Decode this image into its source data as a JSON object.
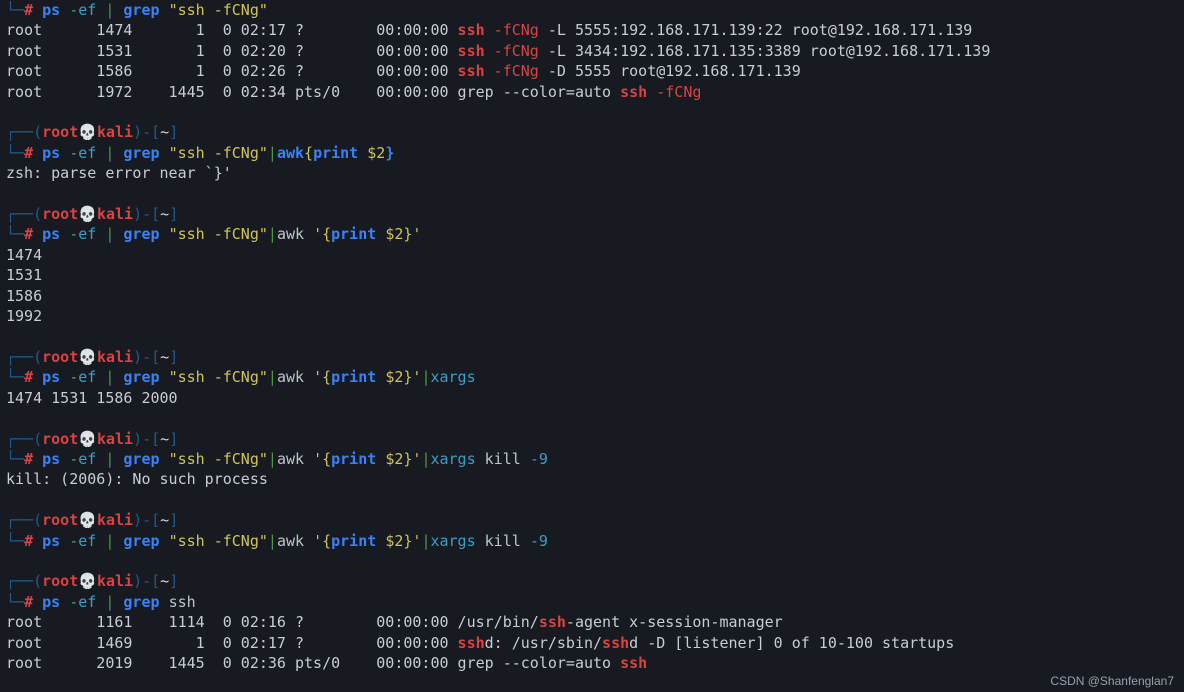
{
  "watermark": "CSDN @Shanfenglan7",
  "prompt": {
    "l1": "┌──(",
    "user": "root",
    "skull": "💀",
    "host": "kali",
    "l2": ")-[",
    "cwd": "~",
    "l3": "]",
    "l4": "└─",
    "hash": "#"
  },
  "cmd": {
    "ps": "ps",
    "ef": "-ef",
    "pipe": "|",
    "grep": "grep",
    "awk": "awk",
    "xargs": "xargs",
    "kill": "kill",
    "nine": "-9",
    "pat_q": "\"ssh -fCNg\"",
    "ssh_plain": "ssh",
    "p1": "{",
    "print": "print",
    "d2": "$2",
    "p2": "}",
    "sq": "'"
  },
  "hl": {
    "ssh": "ssh",
    "fcng": "-fCNg"
  },
  "ps1": {
    "r1": {
      "u": "root",
      "pid": "1474",
      "ppid": "1",
      "c": "0",
      "stime": "02:17",
      "tty": "?",
      "time": "00:00:00",
      "tail": " -L 5555:192.168.171.139:22 root@192.168.171.139"
    },
    "r2": {
      "u": "root",
      "pid": "1531",
      "ppid": "1",
      "c": "0",
      "stime": "02:20",
      "tty": "?",
      "time": "00:00:00",
      "tail": " -L 3434:192.168.171.135:3389 root@192.168.171.139"
    },
    "r3": {
      "u": "root",
      "pid": "1586",
      "ppid": "1",
      "c": "0",
      "stime": "02:26",
      "tty": "?",
      "time": "00:00:00",
      "tail": " -D 5555 root@192.168.171.139"
    },
    "r4": {
      "u": "root",
      "pid": "1972",
      "ppid": "1445",
      "c": "0",
      "stime": "02:34",
      "tty": "pts/0",
      "time": "00:00:00",
      "pre": "grep --color=auto "
    }
  },
  "err1": "zsh: parse error near `}'",
  "pids": {
    "a": "1474",
    "b": "1531",
    "c": "1586",
    "d": "1992"
  },
  "xline": "1474 1531 1586 2000",
  "killerr": "kill: (2006): No such process",
  "ps2": {
    "r1": {
      "u": "root",
      "pid": "1161",
      "ppid": "1114",
      "c": "0",
      "stime": "02:16",
      "tty": "?",
      "time": "00:00:00",
      "a": "/usr/bin/",
      "b": "-agent x-session-manager"
    },
    "r2": {
      "u": "root",
      "pid": "1469",
      "ppid": "1",
      "c": "0",
      "stime": "02:17",
      "tty": "?",
      "time": "00:00:00",
      "a": "d: /usr/sbin/",
      "b": "d -D [listener] 0 of 10-100 startups"
    },
    "r3": {
      "u": "root",
      "pid": "2019",
      "ppid": "1445",
      "c": "0",
      "stime": "02:36",
      "tty": "pts/0",
      "time": "00:00:00",
      "a": "grep --color=auto "
    }
  }
}
